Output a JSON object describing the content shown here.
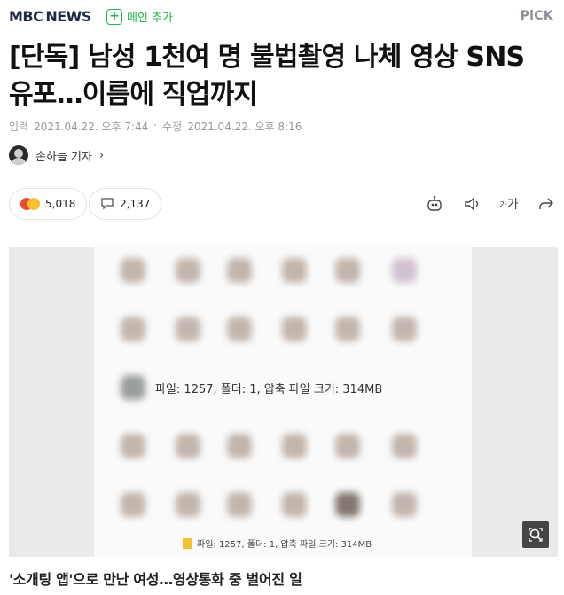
{
  "header": {
    "logo_mbc": "MBC",
    "logo_news": "NEWS",
    "add_main": "메인 추가",
    "pick": "PiCK"
  },
  "article": {
    "title": "[단독] 남성 1천여 명 불법촬영 나체 영상 SNS 유포…이름에 직업까지",
    "date_input_label": "입력",
    "date_input": "2021.04.22. 오후 7:44",
    "date_sep": "·",
    "date_modified_label": "수정",
    "date_modified": "2021.04.22. 오후 8:16",
    "reporter": "손하늘 기자",
    "reporter_chevron": "›",
    "reactions_count": "5,018",
    "comments_count": "2,137",
    "image_overlay_text": "파일: 1257, 폴더: 1, 압축 파일 크기: 314MB",
    "image_bottom_text": "파일: 1257, 폴더: 1, 압축 파일 크기: 314MB",
    "caption": "'소개팅 앱'으로 만난 여성…영상통화 중 벌어진 일"
  },
  "icons": {
    "add": "plus-icon",
    "avatar": "reporter-avatar",
    "comment": "comment-icon",
    "robot": "summary-bot-icon",
    "audio": "speaker-icon",
    "font": "font-size-icon",
    "share": "share-icon",
    "zoom": "zoom-icon"
  },
  "colors": {
    "accent_green": "#22b24c",
    "brand_navy": "#1f2a44",
    "muted": "#999999"
  }
}
